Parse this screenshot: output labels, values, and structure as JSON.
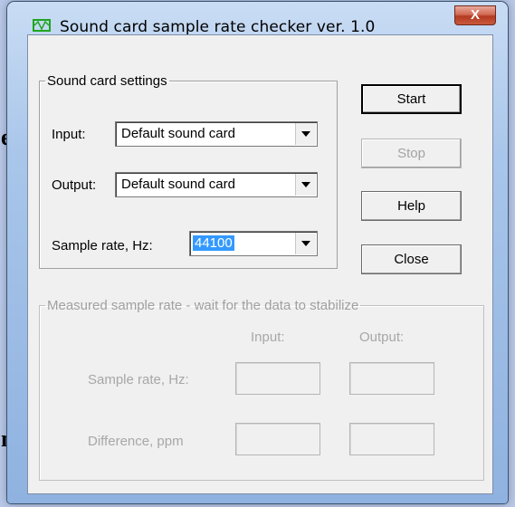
{
  "background": {
    "fragment_top": "e",
    "fragment_bottom": "n"
  },
  "window": {
    "title": "Sound card sample rate checker ver. 1.0",
    "close_label": "X"
  },
  "settings": {
    "group_label": "Sound card settings",
    "input_label": "Input:",
    "input_value": "Default sound card",
    "output_label": "Output:",
    "output_value": "Default sound card",
    "rate_label": "Sample rate, Hz:",
    "rate_value": "44100"
  },
  "buttons": {
    "start": "Start",
    "stop": "Stop",
    "help": "Help",
    "close": "Close"
  },
  "measured": {
    "group_label": "Measured sample rate - wait for the data to stabilize",
    "col_input": "Input:",
    "col_output": "Output:",
    "row_rate": "Sample rate, Hz:",
    "row_diff": "Difference, ppm",
    "rate_input": "",
    "rate_output": "",
    "diff_input": "",
    "diff_output": ""
  },
  "colors": {
    "selection": "#3399ff",
    "close_button": "#c95a3d",
    "disabled_text": "#a7a7a7"
  },
  "icons": {
    "app": "sound-wave-icon",
    "close": "close-icon",
    "dropdown": "chevron-down-icon"
  }
}
